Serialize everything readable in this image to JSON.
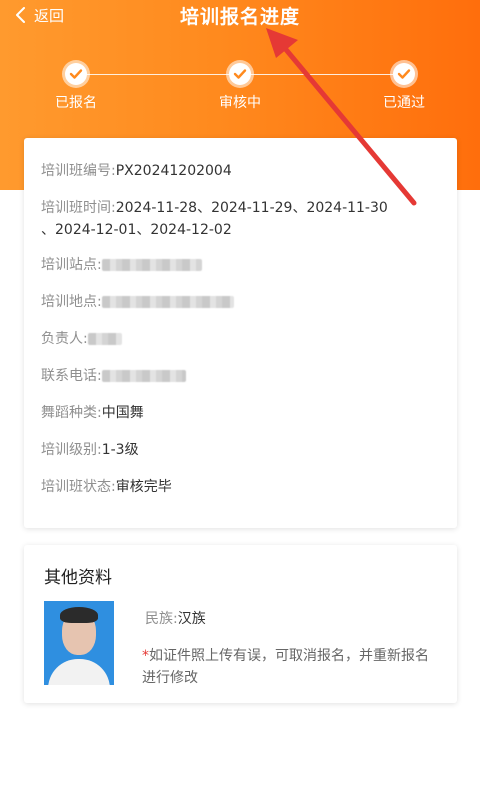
{
  "header": {
    "back_label": "返回",
    "title": "培训报名进度"
  },
  "steps": [
    {
      "label": "已报名"
    },
    {
      "label": "审核中"
    },
    {
      "label": "已通过"
    }
  ],
  "info": {
    "code_label": "培训班编号:",
    "code_value": "PX20241202004",
    "time_label": "培训班时间:",
    "time_line1": "2024-11-28、2024-11-29、2024-11-30",
    "time_line2": "、2024-12-01、2024-12-02",
    "site_label": "培训站点:",
    "place_label": "培训地点:",
    "owner_label": "负责人:",
    "phone_label": "联系电话:",
    "dance_label": "舞蹈种类:",
    "dance_value": "中国舞",
    "level_label": "培训级别:",
    "level_value": "1-3级",
    "status_label": "培训班状态:",
    "status_value": "审核完毕"
  },
  "other": {
    "heading": "其他资料",
    "nation_label": "民族:",
    "nation_value": "汉族",
    "note_star": "*",
    "note_text": "如证件照上传有误，可取消报名，并重新报名进行修改"
  },
  "colors": {
    "header_start": "#ff9a2e",
    "header_end": "#ff6e0c",
    "annotation_arrow": "#e53935"
  }
}
